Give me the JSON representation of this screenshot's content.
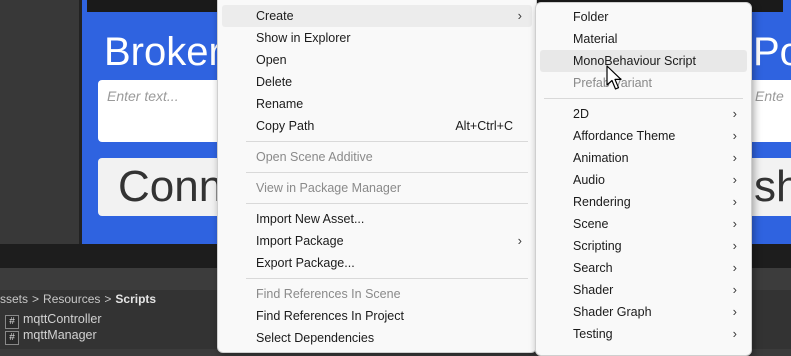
{
  "scene": {
    "broker_label": "Broker",
    "port_label": "Por",
    "broker_placeholder": "Enter text...",
    "port_placeholder": "Ente",
    "connect_label": "Conn",
    "publish_label": "sh"
  },
  "breadcrumb": {
    "items": [
      "ssets",
      "Resources",
      "Scripts"
    ],
    "separator": ">"
  },
  "files": [
    {
      "icon": "#",
      "name": "mqttController"
    },
    {
      "icon": "#",
      "name": "mqttManager"
    }
  ],
  "context_menu": {
    "create": "Create",
    "show_in_explorer": "Show in Explorer",
    "open": "Open",
    "delete": "Delete",
    "rename": "Rename",
    "copy_path": "Copy Path",
    "copy_path_shortcut": "Alt+Ctrl+C",
    "open_scene_additive": "Open Scene Additive",
    "view_in_package_manager": "View in Package Manager",
    "import_new_asset": "Import New Asset...",
    "import_package": "Import Package",
    "export_package": "Export Package...",
    "find_references_in_scene": "Find References In Scene",
    "find_references_in_project": "Find References In Project",
    "select_dependencies": "Select Dependencies"
  },
  "create_submenu": {
    "folder": "Folder",
    "material": "Material",
    "monobehaviour_script": "MonoBehaviour Script",
    "prefab_variant": "Prefab Variant",
    "items_2d": "2D",
    "affordance_theme": "Affordance Theme",
    "animation": "Animation",
    "audio": "Audio",
    "rendering": "Rendering",
    "scene": "Scene",
    "scripting": "Scripting",
    "search": "Search",
    "shader": "Shader",
    "shader_graph": "Shader Graph",
    "testing": "Testing"
  },
  "colors": {
    "game_blue": "#2f63e0",
    "menu_bg": "#f9f9f9",
    "highlight": "#ececec"
  },
  "icons": {
    "submenu_arrow": "chevron-right-icon",
    "pointer": "mouse-cursor-icon",
    "script_file": "csharp-script-icon"
  }
}
